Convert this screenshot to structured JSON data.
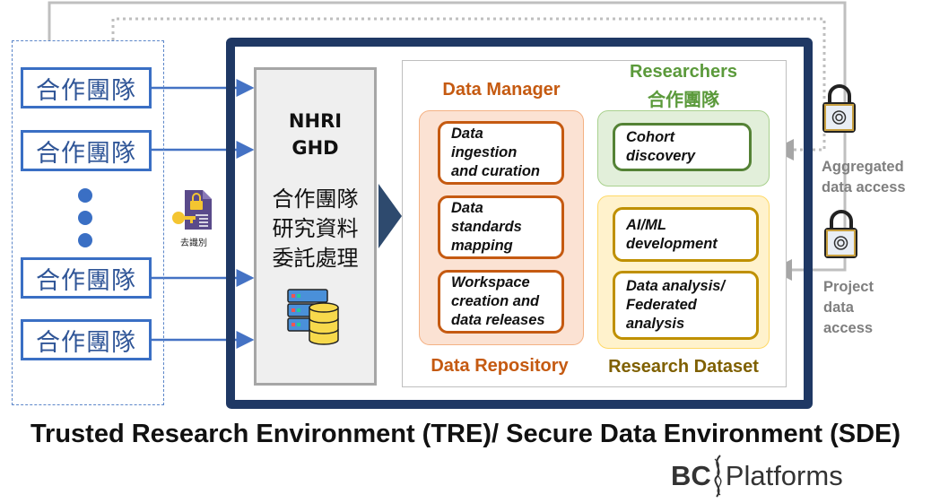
{
  "teams": {
    "label": "合作團隊",
    "count_shown": 4
  },
  "deidentify": {
    "label": "去識別",
    "icon": "locked-document-key-icon"
  },
  "nhri": {
    "line1": "NHRI",
    "line2": "GHD",
    "desc1": "合作團隊",
    "desc2": "研究資料",
    "desc3": "委託處理",
    "icon": "server-database-icon"
  },
  "data_manager": {
    "title": "Data Manager",
    "footer": "Data Repository",
    "items": [
      [
        "Data",
        "ingestion",
        "and curation"
      ],
      [
        "Data",
        "standards",
        "mapping"
      ],
      [
        "Workspace",
        "creation and",
        "data releases"
      ]
    ]
  },
  "researchers": {
    "title": "Researchers",
    "subtitle": "合作團隊",
    "items": [
      [
        "Cohort",
        "discovery"
      ]
    ]
  },
  "research_dataset": {
    "footer": "Research Dataset",
    "items": [
      [
        "AI/ML",
        "development"
      ],
      [
        "Data analysis/",
        "Federated",
        "analysis"
      ]
    ]
  },
  "access": {
    "aggregated": [
      "Aggregated",
      "data access"
    ],
    "project": [
      "Project",
      "data",
      "access"
    ],
    "icon": "fingerprint-padlock-icon"
  },
  "title": "Trusted Research Environment (TRE)/ Secure Data Environment (SDE)",
  "logo": {
    "left": "BC",
    "right": "Platforms"
  },
  "colors": {
    "team_blue": "#3a6fc4",
    "navy": "#1f3864",
    "orange": "#c55a11",
    "green": "#548235",
    "gold": "#bf9000",
    "gray": "#7f7f7f"
  }
}
